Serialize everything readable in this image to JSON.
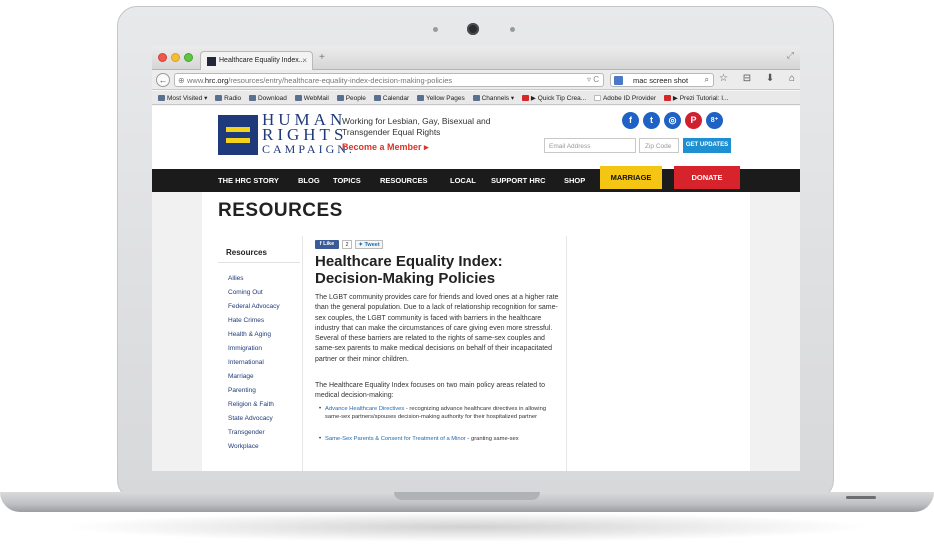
{
  "browser": {
    "tab_title": "Healthcare Equality Index...",
    "tab_close": "×",
    "new_tab": "+",
    "url_prefix": "www.",
    "url_domain": "hrc.org",
    "url_path": "/resources/entry/healthcare-equality-index-decision-making-policies",
    "url_tail": "▿ C",
    "search_value": "mac screen shot",
    "back": "←",
    "nav_icons": "☆ ⊟ ⬇ ⌂ ≡",
    "bookmarks": [
      {
        "label": "Most Visited ▾",
        "icon": "folder"
      },
      {
        "label": "Radio",
        "icon": "hrc"
      },
      {
        "label": "Download",
        "icon": "hrc"
      },
      {
        "label": "WebMail",
        "icon": "hrc"
      },
      {
        "label": "People",
        "icon": "hrc"
      },
      {
        "label": "Calendar",
        "icon": "hrc"
      },
      {
        "label": "Yellow Pages",
        "icon": "hrc"
      },
      {
        "label": "Channels ▾",
        "icon": "folder"
      },
      {
        "label": "▶ Quick Tip Crea...",
        "icon": "youtube"
      },
      {
        "label": "Adobe ID Provider",
        "icon": "blank"
      },
      {
        "label": "▶ Prezi Tutorial: I...",
        "icon": "youtube"
      }
    ]
  },
  "header": {
    "logo_line1": "HUMAN",
    "logo_line2": "RIGHTS",
    "logo_line3": "CAMPAIGN.",
    "tagline": "Working for Lesbian, Gay, Bisexual and Transgender Equal Rights",
    "become_member": "Become a Member ▸",
    "email_placeholder": "Email Address",
    "zip_placeholder": "Zip Code",
    "get_updates": "GET UPDATES",
    "social": [
      "f",
      "t",
      "◎",
      "P",
      "8⁺"
    ]
  },
  "nav": {
    "items": [
      "THE HRC STORY",
      "BLOG",
      "TOPICS",
      "RESOURCES",
      "LOCAL",
      "SUPPORT HRC",
      "SHOP"
    ],
    "marriage": "MARRIAGE",
    "donate": "DONATE"
  },
  "page": {
    "title": "RESOURCES"
  },
  "sidebar": {
    "heading": "Resources",
    "items": [
      "Allies",
      "Coming Out",
      "Federal Advocacy",
      "Hate Crimes",
      "Health & Aging",
      "Immigration",
      "International",
      "Marriage",
      "Parenting",
      "Religion & Faith",
      "State Advocacy",
      "Transgender",
      "Workplace"
    ]
  },
  "article": {
    "like": "Like",
    "like_count": "2",
    "tweet": "Tweet",
    "title_line1": "Healthcare Equality Index:",
    "title_line2": "Decision-Making Policies",
    "para1": "The LGBT community provides care for friends and loved ones at a higher rate than the general population. Due to a lack of relationship recognition for same-sex couples, the LGBT community is faced with barriers in the healthcare industry that can make the circumstances of care giving even more stressful. Several of these barriers are related to the rights of same-sex couples and same-sex parents to make medical decisions on behalf of their incapacitated partner or their minor children.",
    "para2": "The Healthcare Equality Index focuses on two main policy areas related to medical decision-making:",
    "bullet1_link": "Advance Healthcare Directives",
    "bullet1_text": " - recognizing advance healthcare directives in allowing same-sex partners/spouses decision-making authority for their hospitalized partner",
    "bullet2_link": "Same-Sex Parents & Consent for Treatment of a Minor",
    "bullet2_text": " - granting same-sex"
  }
}
